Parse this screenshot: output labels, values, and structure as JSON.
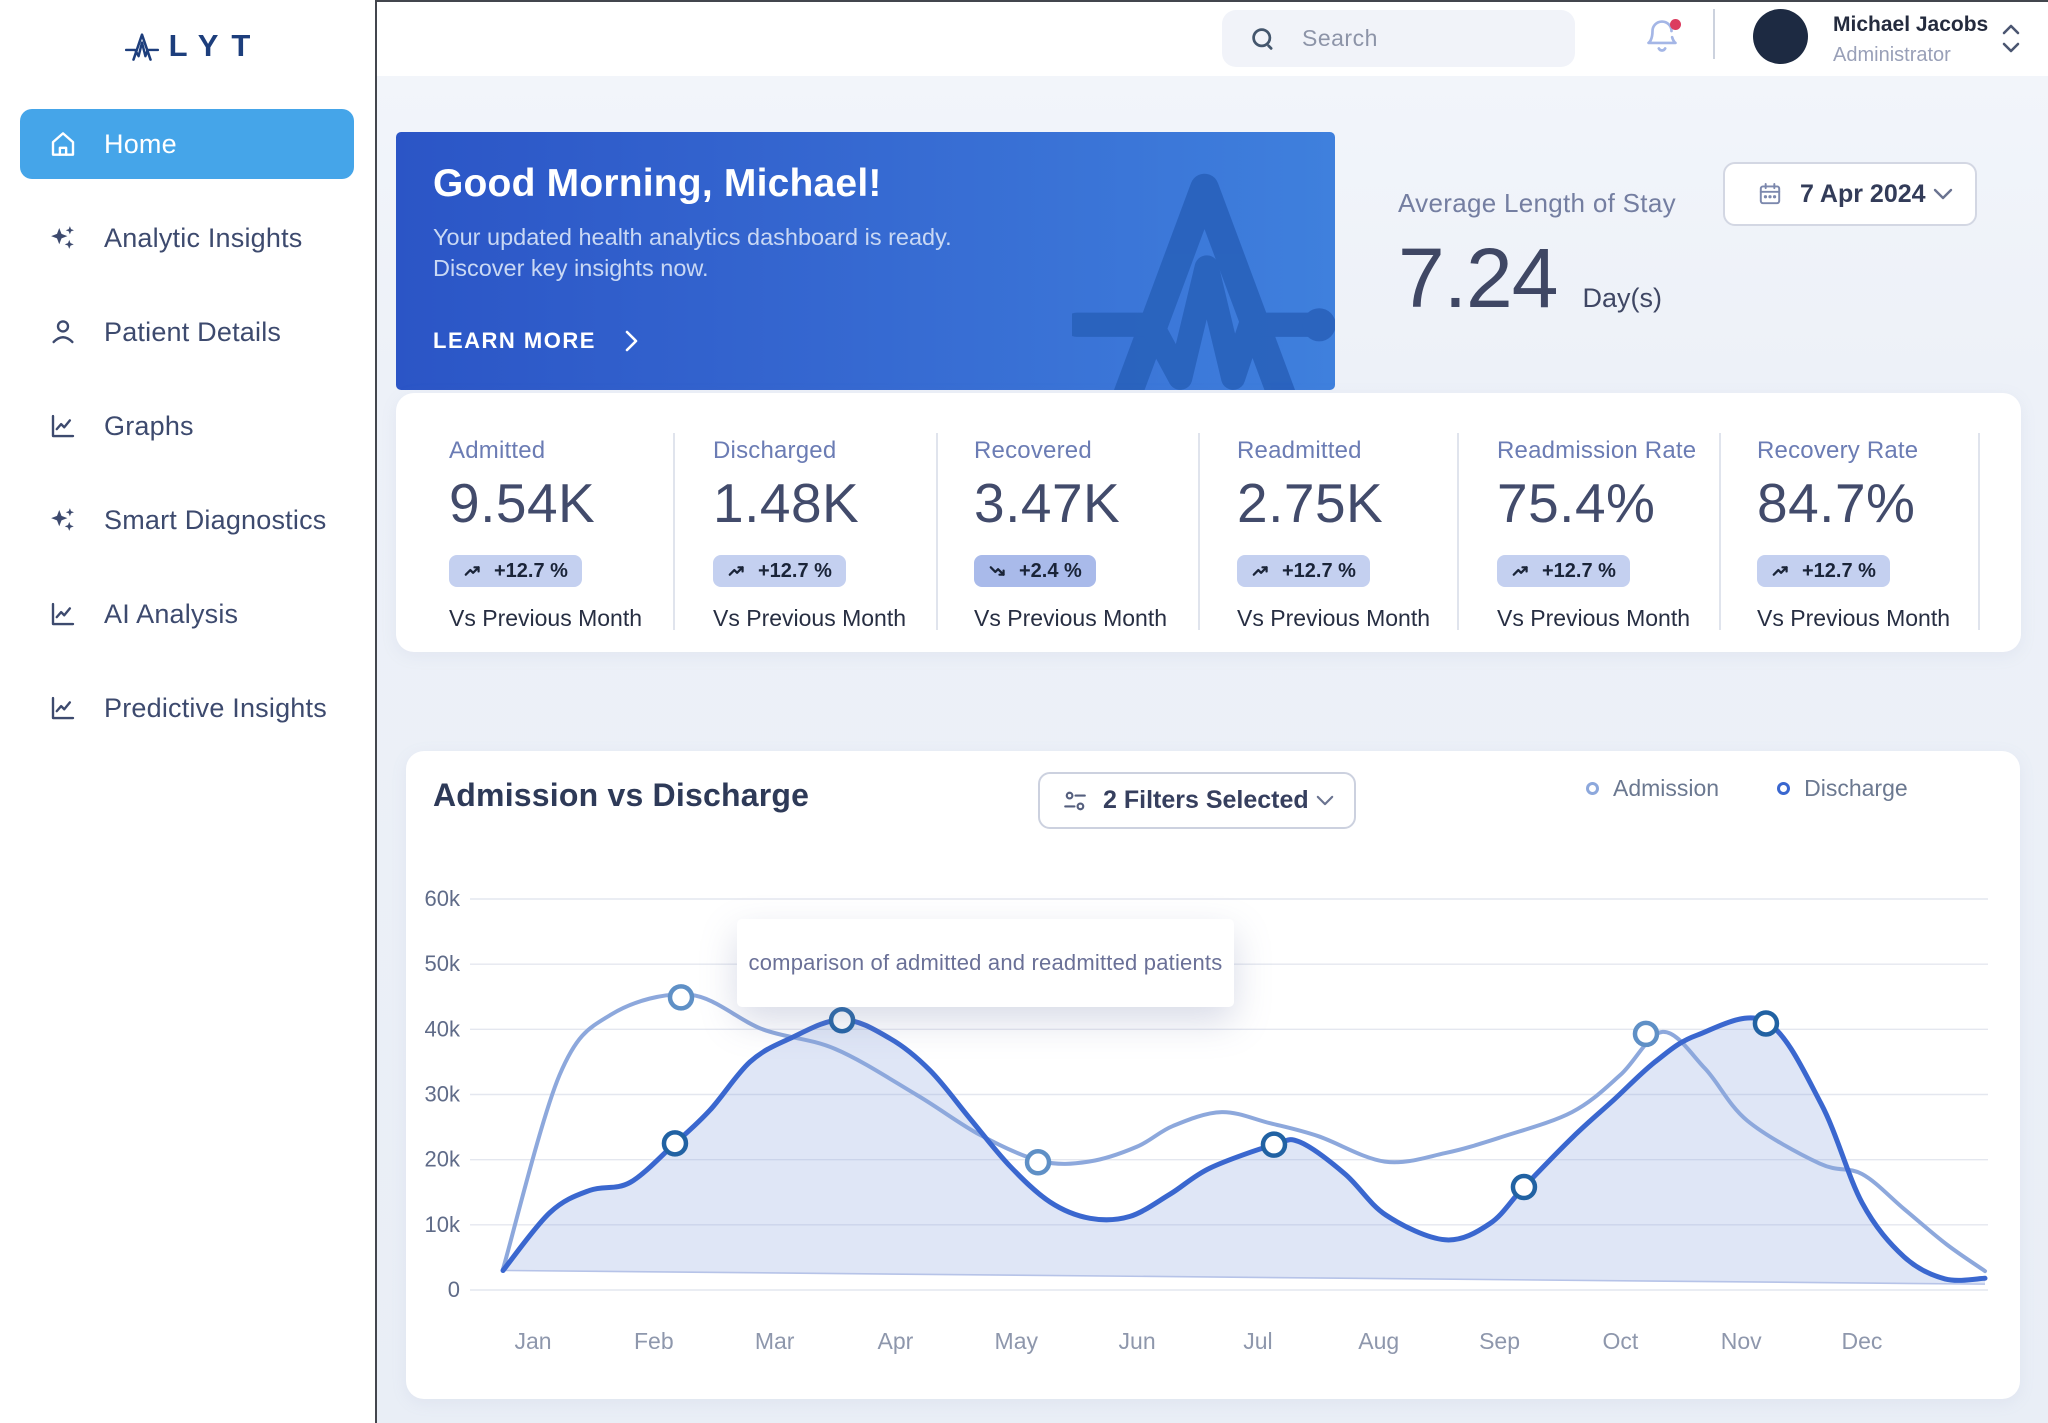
{
  "brand": {
    "logo_text": "LYT"
  },
  "sidebar": {
    "items": [
      {
        "label": "Home",
        "icon": "home",
        "active": true
      },
      {
        "label": "Analytic Insights",
        "icon": "sparkles",
        "active": false
      },
      {
        "label": "Patient Details",
        "icon": "person",
        "active": false
      },
      {
        "label": "Graphs",
        "icon": "chart-line",
        "active": false
      },
      {
        "label": "Smart Diagnostics",
        "icon": "sparkles",
        "active": false
      },
      {
        "label": "AI Analysis",
        "icon": "chart-line",
        "active": false
      },
      {
        "label": "Predictive Insights",
        "icon": "chart-line",
        "active": false
      }
    ]
  },
  "header": {
    "search_placeholder": "Search",
    "has_notification": true,
    "user_name": "Michael Jacobs",
    "user_role": "Administrator"
  },
  "hero": {
    "title": "Good Morning, Michael!",
    "subtitle_line1": "Your updated health analytics dashboard is ready.",
    "subtitle_line2": "Discover key insights now.",
    "cta": "LEARN MORE"
  },
  "avg_stay": {
    "label": "Average Length of Stay",
    "value": "7.24",
    "unit": "Day(s)",
    "date": "7 Apr 2024"
  },
  "stats": [
    {
      "label": "Admitted",
      "value": "9.54K",
      "delta": "+12.7 %",
      "trend": "up",
      "note": "Vs Previous Month"
    },
    {
      "label": "Discharged",
      "value": "1.48K",
      "delta": "+12.7 %",
      "trend": "up",
      "note": "Vs Previous Month"
    },
    {
      "label": "Recovered",
      "value": "3.47K",
      "delta": "+2.4 %",
      "trend": "down",
      "note": "Vs Previous Month"
    },
    {
      "label": "Readmitted",
      "value": "2.75K",
      "delta": "+12.7 %",
      "trend": "up",
      "note": "Vs Previous Month"
    },
    {
      "label": "Readmission Rate",
      "value": "75.4%",
      "delta": "+12.7 %",
      "trend": "up",
      "note": "Vs Previous Month"
    },
    {
      "label": "Recovery Rate",
      "value": "84.7%",
      "delta": "+12.7 %",
      "trend": "up",
      "note": "Vs Previous Month"
    }
  ],
  "chart_card": {
    "title": "Admission vs Discharge",
    "filter_label": "2 Filters Selected",
    "tooltip": "comparison of admitted and readmitted patients"
  },
  "chart_data": {
    "type": "line",
    "title": "Admission vs Discharge",
    "x_labels": [
      "Jan",
      "Feb",
      "Mar",
      "Apr",
      "May",
      "Jun",
      "Jul",
      "Aug",
      "Sep",
      "Oct",
      "Nov",
      "Dec"
    ],
    "y_tick_labels": [
      "0",
      "10k",
      "20k",
      "30k",
      "40k",
      "50k",
      "60k"
    ],
    "y_ticks": [
      0,
      10000,
      20000,
      30000,
      40000,
      50000,
      60000
    ],
    "ylim": [
      0,
      60000
    ],
    "grid": true,
    "legend_position": "top-right",
    "annotation": "comparison of admitted and readmitted patients",
    "series": [
      {
        "name": "Admission",
        "color": "#8da8dc",
        "marker_color": "#5f90c6",
        "line_width": 4,
        "points": [
          [
            -0.248,
            3200
          ],
          [
            0.22,
            33000
          ],
          [
            0.65,
            42300
          ],
          [
            1.3,
            45300
          ],
          [
            1.9,
            40000
          ],
          [
            2.5,
            37000
          ],
          [
            3.17,
            30000
          ],
          [
            3.7,
            23800
          ],
          [
            4.2,
            19800
          ],
          [
            4.6,
            19700
          ],
          [
            5.0,
            22000
          ],
          [
            5.3,
            25200
          ],
          [
            5.7,
            27300
          ],
          [
            6.1,
            25600
          ],
          [
            6.5,
            23600
          ],
          [
            7.05,
            19700
          ],
          [
            7.55,
            21000
          ],
          [
            8.02,
            23500
          ],
          [
            8.6,
            27300
          ],
          [
            9.0,
            33000
          ],
          [
            9.35,
            39600
          ],
          [
            9.7,
            34000
          ],
          [
            10.05,
            26000
          ],
          [
            10.65,
            19400
          ],
          [
            11.0,
            17800
          ],
          [
            11.35,
            12400
          ],
          [
            11.7,
            7000
          ],
          [
            12.018,
            2900
          ]
        ],
        "markers": [
          [
            1.225,
            44900
          ],
          [
            4.18,
            19600
          ],
          [
            9.212,
            39300
          ]
        ]
      },
      {
        "name": "Discharge",
        "color": "#3a67cf",
        "marker_color": "#2162a3",
        "line_width": 5,
        "fill": true,
        "fill_color": "rgba(141,164,221,0.28)",
        "fill_baseline": [
          [
            -0.248,
            3000
          ],
          [
            12.018,
            900
          ]
        ],
        "points": [
          [
            -0.248,
            3000
          ],
          [
            0.141,
            11900
          ],
          [
            0.472,
            15300
          ],
          [
            0.803,
            16500
          ],
          [
            1.175,
            22500
          ],
          [
            1.465,
            27600
          ],
          [
            1.796,
            35000
          ],
          [
            2.127,
            38600
          ],
          [
            2.558,
            41500
          ],
          [
            2.955,
            38600
          ],
          [
            3.286,
            33700
          ],
          [
            3.617,
            26300
          ],
          [
            3.948,
            19000
          ],
          [
            4.279,
            13500
          ],
          [
            4.61,
            11000
          ],
          [
            4.941,
            11300
          ],
          [
            5.272,
            14700
          ],
          [
            5.603,
            18700
          ],
          [
            6.133,
            22300
          ],
          [
            6.348,
            22700
          ],
          [
            6.721,
            17800
          ],
          [
            7.06,
            11500
          ],
          [
            7.549,
            7700
          ],
          [
            7.921,
            10200
          ],
          [
            8.202,
            15800
          ],
          [
            8.608,
            23500
          ],
          [
            8.947,
            29200
          ],
          [
            9.287,
            35000
          ],
          [
            9.634,
            39100
          ],
          [
            10.205,
            41200
          ],
          [
            10.661,
            28600
          ],
          [
            11.0,
            13400
          ],
          [
            11.348,
            5100
          ],
          [
            11.687,
            1700
          ],
          [
            12.018,
            1800
          ]
        ],
        "markers": [
          [
            1.175,
            22500
          ],
          [
            2.558,
            41400
          ],
          [
            6.133,
            22300
          ],
          [
            8.202,
            15800
          ],
          [
            10.205,
            40900
          ]
        ]
      }
    ]
  }
}
